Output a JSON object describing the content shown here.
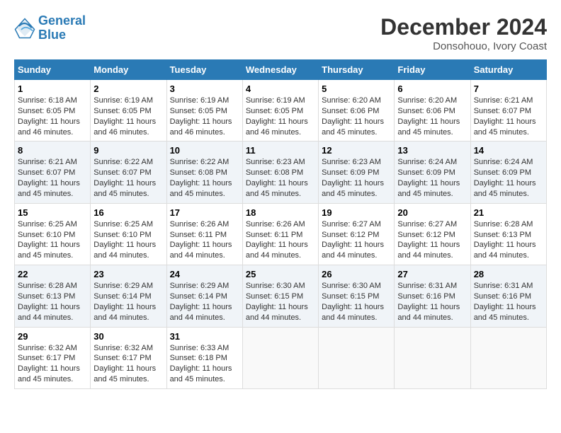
{
  "logo": {
    "line1": "General",
    "line2": "Blue"
  },
  "title": "December 2024",
  "subtitle": "Donsohouo, Ivory Coast",
  "days_of_week": [
    "Sunday",
    "Monday",
    "Tuesday",
    "Wednesday",
    "Thursday",
    "Friday",
    "Saturday"
  ],
  "weeks": [
    [
      {
        "day": 1,
        "rise": "Sunrise: 6:18 AM",
        "set": "Sunset: 6:05 PM",
        "daylight": "Daylight: 11 hours and 46 minutes."
      },
      {
        "day": 2,
        "rise": "Sunrise: 6:19 AM",
        "set": "Sunset: 6:05 PM",
        "daylight": "Daylight: 11 hours and 46 minutes."
      },
      {
        "day": 3,
        "rise": "Sunrise: 6:19 AM",
        "set": "Sunset: 6:05 PM",
        "daylight": "Daylight: 11 hours and 46 minutes."
      },
      {
        "day": 4,
        "rise": "Sunrise: 6:19 AM",
        "set": "Sunset: 6:05 PM",
        "daylight": "Daylight: 11 hours and 46 minutes."
      },
      {
        "day": 5,
        "rise": "Sunrise: 6:20 AM",
        "set": "Sunset: 6:06 PM",
        "daylight": "Daylight: 11 hours and 45 minutes."
      },
      {
        "day": 6,
        "rise": "Sunrise: 6:20 AM",
        "set": "Sunset: 6:06 PM",
        "daylight": "Daylight: 11 hours and 45 minutes."
      },
      {
        "day": 7,
        "rise": "Sunrise: 6:21 AM",
        "set": "Sunset: 6:07 PM",
        "daylight": "Daylight: 11 hours and 45 minutes."
      }
    ],
    [
      {
        "day": 8,
        "rise": "Sunrise: 6:21 AM",
        "set": "Sunset: 6:07 PM",
        "daylight": "Daylight: 11 hours and 45 minutes."
      },
      {
        "day": 9,
        "rise": "Sunrise: 6:22 AM",
        "set": "Sunset: 6:07 PM",
        "daylight": "Daylight: 11 hours and 45 minutes."
      },
      {
        "day": 10,
        "rise": "Sunrise: 6:22 AM",
        "set": "Sunset: 6:08 PM",
        "daylight": "Daylight: 11 hours and 45 minutes."
      },
      {
        "day": 11,
        "rise": "Sunrise: 6:23 AM",
        "set": "Sunset: 6:08 PM",
        "daylight": "Daylight: 11 hours and 45 minutes."
      },
      {
        "day": 12,
        "rise": "Sunrise: 6:23 AM",
        "set": "Sunset: 6:09 PM",
        "daylight": "Daylight: 11 hours and 45 minutes."
      },
      {
        "day": 13,
        "rise": "Sunrise: 6:24 AM",
        "set": "Sunset: 6:09 PM",
        "daylight": "Daylight: 11 hours and 45 minutes."
      },
      {
        "day": 14,
        "rise": "Sunrise: 6:24 AM",
        "set": "Sunset: 6:09 PM",
        "daylight": "Daylight: 11 hours and 45 minutes."
      }
    ],
    [
      {
        "day": 15,
        "rise": "Sunrise: 6:25 AM",
        "set": "Sunset: 6:10 PM",
        "daylight": "Daylight: 11 hours and 45 minutes."
      },
      {
        "day": 16,
        "rise": "Sunrise: 6:25 AM",
        "set": "Sunset: 6:10 PM",
        "daylight": "Daylight: 11 hours and 44 minutes."
      },
      {
        "day": 17,
        "rise": "Sunrise: 6:26 AM",
        "set": "Sunset: 6:11 PM",
        "daylight": "Daylight: 11 hours and 44 minutes."
      },
      {
        "day": 18,
        "rise": "Sunrise: 6:26 AM",
        "set": "Sunset: 6:11 PM",
        "daylight": "Daylight: 11 hours and 44 minutes."
      },
      {
        "day": 19,
        "rise": "Sunrise: 6:27 AM",
        "set": "Sunset: 6:12 PM",
        "daylight": "Daylight: 11 hours and 44 minutes."
      },
      {
        "day": 20,
        "rise": "Sunrise: 6:27 AM",
        "set": "Sunset: 6:12 PM",
        "daylight": "Daylight: 11 hours and 44 minutes."
      },
      {
        "day": 21,
        "rise": "Sunrise: 6:28 AM",
        "set": "Sunset: 6:13 PM",
        "daylight": "Daylight: 11 hours and 44 minutes."
      }
    ],
    [
      {
        "day": 22,
        "rise": "Sunrise: 6:28 AM",
        "set": "Sunset: 6:13 PM",
        "daylight": "Daylight: 11 hours and 44 minutes."
      },
      {
        "day": 23,
        "rise": "Sunrise: 6:29 AM",
        "set": "Sunset: 6:14 PM",
        "daylight": "Daylight: 11 hours and 44 minutes."
      },
      {
        "day": 24,
        "rise": "Sunrise: 6:29 AM",
        "set": "Sunset: 6:14 PM",
        "daylight": "Daylight: 11 hours and 44 minutes."
      },
      {
        "day": 25,
        "rise": "Sunrise: 6:30 AM",
        "set": "Sunset: 6:15 PM",
        "daylight": "Daylight: 11 hours and 44 minutes."
      },
      {
        "day": 26,
        "rise": "Sunrise: 6:30 AM",
        "set": "Sunset: 6:15 PM",
        "daylight": "Daylight: 11 hours and 44 minutes."
      },
      {
        "day": 27,
        "rise": "Sunrise: 6:31 AM",
        "set": "Sunset: 6:16 PM",
        "daylight": "Daylight: 11 hours and 44 minutes."
      },
      {
        "day": 28,
        "rise": "Sunrise: 6:31 AM",
        "set": "Sunset: 6:16 PM",
        "daylight": "Daylight: 11 hours and 45 minutes."
      }
    ],
    [
      {
        "day": 29,
        "rise": "Sunrise: 6:32 AM",
        "set": "Sunset: 6:17 PM",
        "daylight": "Daylight: 11 hours and 45 minutes."
      },
      {
        "day": 30,
        "rise": "Sunrise: 6:32 AM",
        "set": "Sunset: 6:17 PM",
        "daylight": "Daylight: 11 hours and 45 minutes."
      },
      {
        "day": 31,
        "rise": "Sunrise: 6:33 AM",
        "set": "Sunset: 6:18 PM",
        "daylight": "Daylight: 11 hours and 45 minutes."
      },
      null,
      null,
      null,
      null
    ]
  ]
}
